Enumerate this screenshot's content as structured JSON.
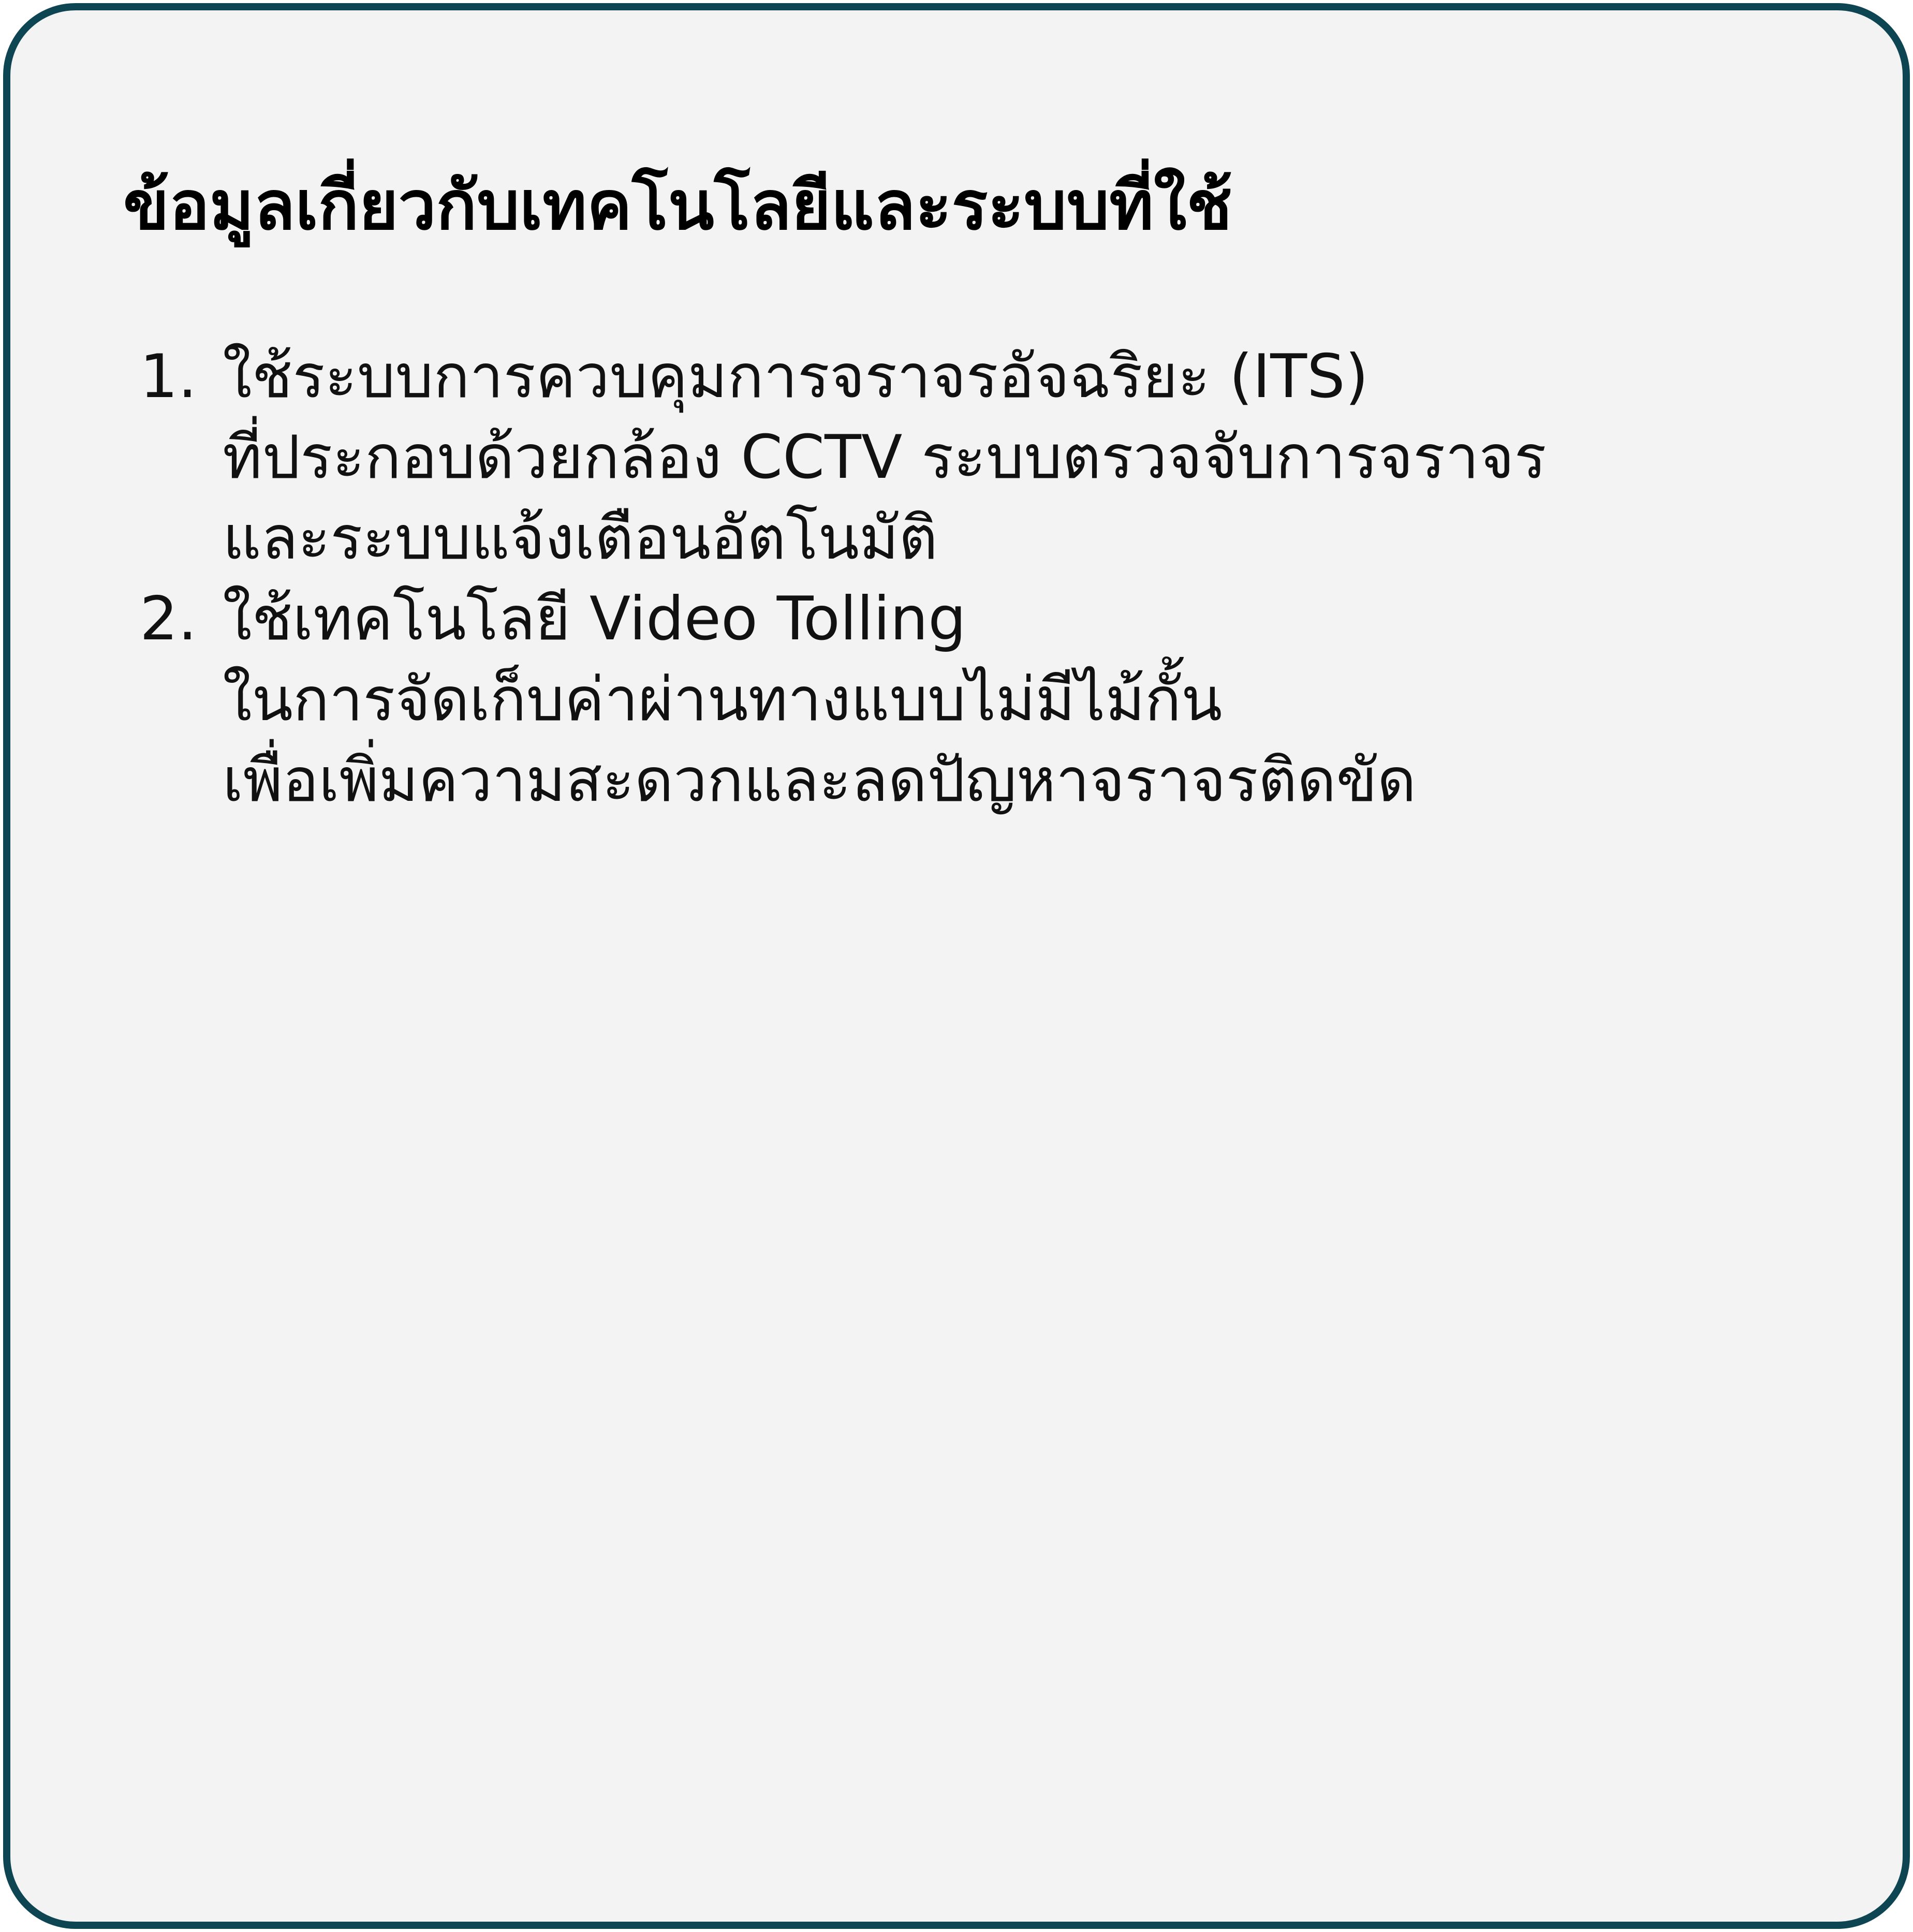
{
  "panel": {
    "title": "ข้อมูลเกี่ยวกับเทคโนโลยีและระบบที่ใช้",
    "items": [
      {
        "number": "1.",
        "lines": [
          "ใช้ระบบการควบคุมการจราจรอัจฉริยะ (ITS)",
          "ที่ประกอบด้วยกล้อง CCTV ระบบตรวจจับการจราจร",
          "และระบบแจ้งเตือนอัตโนมัติ"
        ]
      },
      {
        "number": "2.",
        "lines": [
          "ใช้เทคโนโลยี Video Tolling",
          "ในการจัดเก็บค่าผ่านทางแบบไม่มีไม้กั้น",
          "เพื่อเพิ่มความสะดวกและลดปัญหาจราจรติดขัด"
        ]
      }
    ],
    "colors": {
      "border": "#0d4553",
      "background": "#f3f3f3",
      "text": "#000000"
    }
  }
}
